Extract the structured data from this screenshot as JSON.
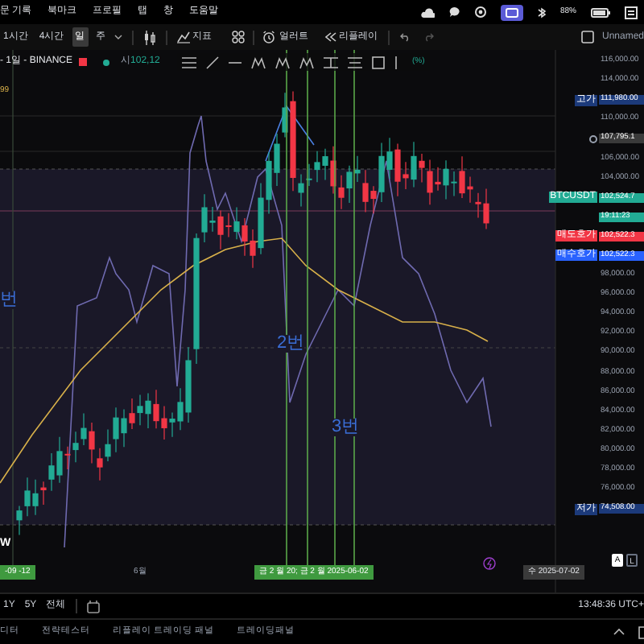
{
  "menu_bar": {
    "items": [
      "문 기록",
      "북마크",
      "프로필",
      "탭",
      "창",
      "도움말"
    ],
    "battery": "88%"
  },
  "toolbar": {
    "intervals": [
      {
        "label": "1시간",
        "selected": false
      },
      {
        "label": "4시간",
        "selected": false
      },
      {
        "label": "일",
        "selected": true
      },
      {
        "label": "주",
        "selected": false
      }
    ],
    "indicators": "지표",
    "alert": "얼러트",
    "replay": "리플레이",
    "layout_name": "Unnamed"
  },
  "symbol": {
    "title": "- 1일 - BINANCE",
    "open_label": "시",
    "open_value": "102,12",
    "percent_label": "(%)"
  },
  "annotations": [
    {
      "kind": "level",
      "text": "99"
    },
    {
      "kind": "note",
      "text": "번"
    },
    {
      "kind": "note",
      "text": "2번"
    },
    {
      "kind": "note",
      "text": "3번"
    },
    {
      "kind": "logo",
      "text": "W"
    }
  ],
  "price_axis": [
    {
      "kind": "tick",
      "text": "116,000.00"
    },
    {
      "kind": "tick",
      "text": "114,000.00"
    },
    {
      "kind": "high",
      "label": "고가",
      "text": "111,980.00"
    },
    {
      "kind": "tick",
      "text": "110,000.00"
    },
    {
      "kind": "cursor",
      "text": "107,795.1"
    },
    {
      "kind": "tick",
      "text": "106,000.00"
    },
    {
      "kind": "tick",
      "text": "104,000.00"
    },
    {
      "kind": "last",
      "label": "BTCUSDT",
      "text": "102,524.7"
    },
    {
      "kind": "countdown",
      "text": "19:11:23"
    },
    {
      "kind": "ask",
      "label": "매도호가",
      "text": "102,522.3"
    },
    {
      "kind": "bid",
      "label": "매수호가",
      "text": "102,522.3"
    },
    {
      "kind": "tick",
      "text": "98,000.00"
    },
    {
      "kind": "tick",
      "text": "96,000.00"
    },
    {
      "kind": "tick",
      "text": "94,000.00"
    },
    {
      "kind": "tick",
      "text": "92,000.00"
    },
    {
      "kind": "tick",
      "text": "90,000.00"
    },
    {
      "kind": "tick",
      "text": "88,000.00"
    },
    {
      "kind": "tick",
      "text": "86,000.00"
    },
    {
      "kind": "tick",
      "text": "84,000.00"
    },
    {
      "kind": "tick",
      "text": "82,000.00"
    },
    {
      "kind": "tick",
      "text": "80,000.00"
    },
    {
      "kind": "tick",
      "text": "78,000.00"
    },
    {
      "kind": "tick",
      "text": "76,000.00"
    },
    {
      "kind": "low",
      "label": "저가",
      "text": "74,508.00"
    }
  ],
  "time_axis": [
    {
      "kind": "marker",
      "text": "-09 -12"
    },
    {
      "kind": "plain",
      "text": "6월"
    },
    {
      "kind": "marker",
      "text": "금 2 월 20; 금 2 월 2025-06-02"
    },
    {
      "kind": "cursor",
      "text": "수 2025-07-02"
    }
  ],
  "scale_buttons": [
    {
      "label": "A",
      "selected": true
    },
    {
      "label": "L",
      "selected": false
    }
  ],
  "ranges": [
    "1Y",
    "5Y",
    "전체"
  ],
  "clock": "13:48:36 UTC+",
  "bottom_tabs": [
    "디터",
    "전략테스터",
    "리플레이 트레이딩 패널",
    "트레이딩패널"
  ]
}
